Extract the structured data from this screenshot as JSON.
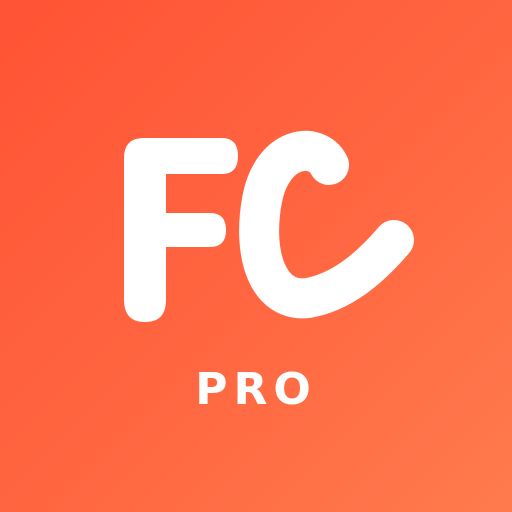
{
  "icon": {
    "logo_text": "FC",
    "edition_label": "PRO",
    "colors": {
      "gradient_start": "#ff5335",
      "gradient_end": "#ff7b4e",
      "foreground": "#ffffff"
    },
    "logo_icon": "fc-logo-icon"
  }
}
